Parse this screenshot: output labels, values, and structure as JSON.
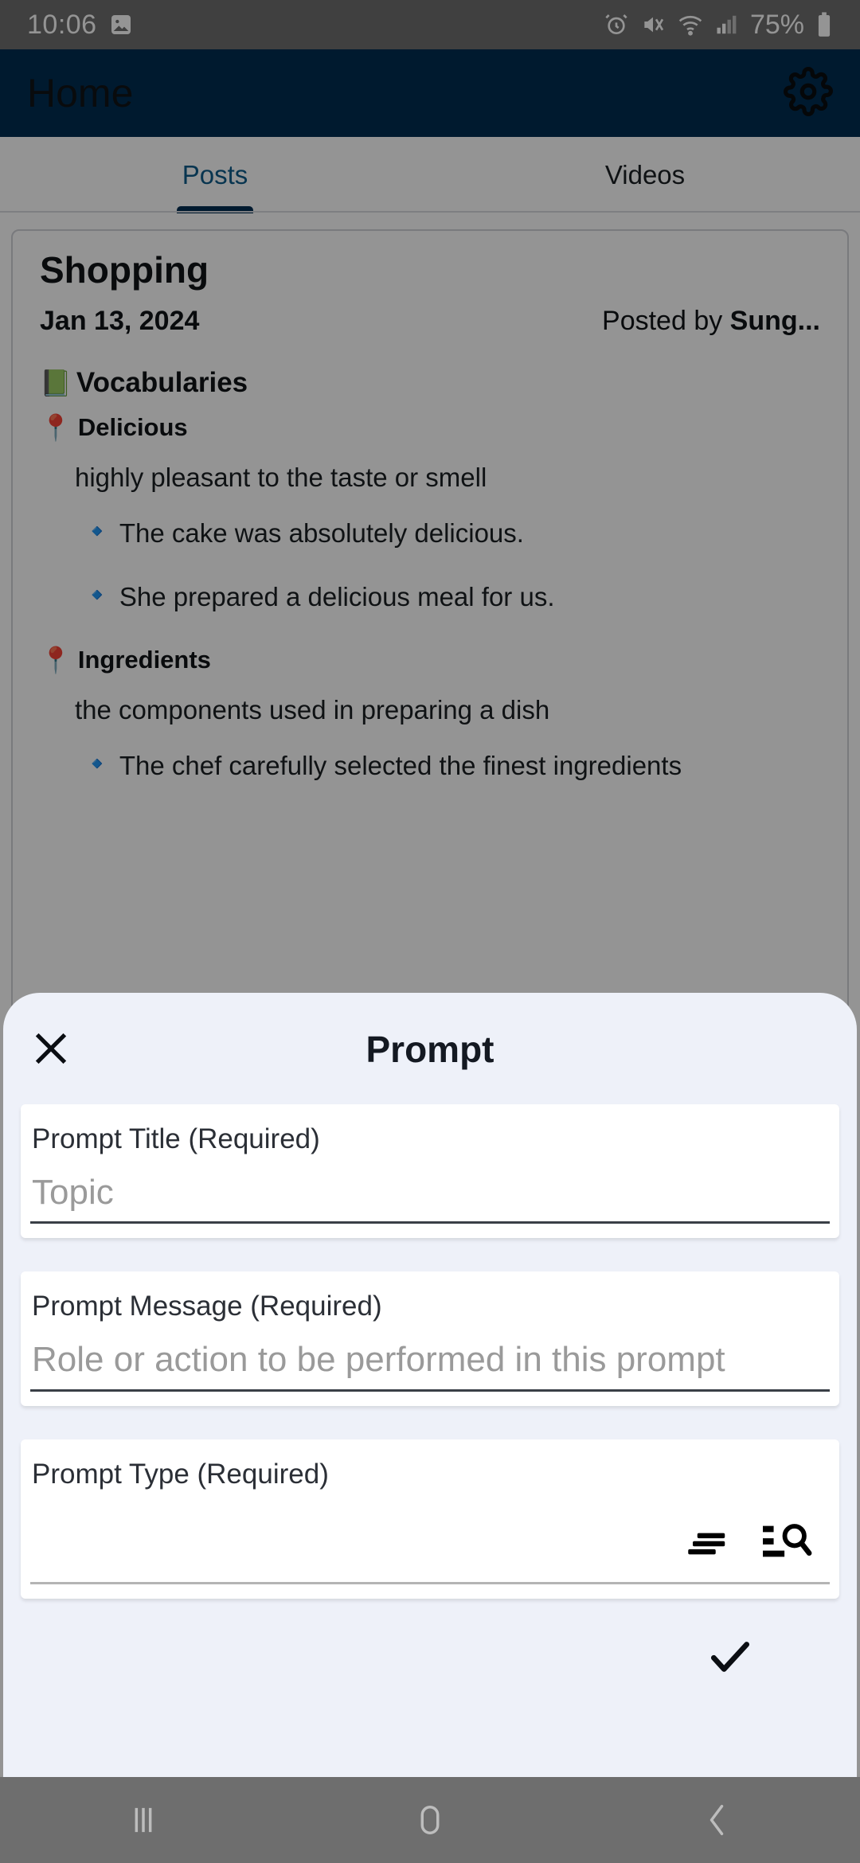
{
  "status_bar": {
    "time": "10:06",
    "battery_percent": "75%",
    "icons": [
      "image-icon",
      "alarm-icon",
      "mute-vibrate-icon",
      "wifi-icon",
      "cellular-signal-icon",
      "battery-icon"
    ]
  },
  "app_bar": {
    "title": "Home",
    "settings_icon": "gear-icon"
  },
  "tabs": [
    {
      "label": "Posts",
      "selected": true
    },
    {
      "label": "Videos",
      "selected": false
    }
  ],
  "post": {
    "title": "Shopping",
    "date": "Jan 13, 2024",
    "posted_by_prefix": "Posted by ",
    "posted_by_name": "Sung...",
    "section_icon": "green-book-emoji",
    "section_title": "Vocabularies",
    "entries": [
      {
        "pin_icon": "round-pushpin-emoji",
        "word": "Delicious",
        "definition": "highly pleasant to the taste or smell",
        "examples": [
          "The cake was absolutely delicious.",
          "She prepared a delicious meal for us."
        ]
      },
      {
        "pin_icon": "round-pushpin-emoji",
        "word": "Ingredients",
        "definition": "the components used in preparing a dish",
        "examples": [
          "The chef carefully selected the finest ingredients"
        ]
      }
    ],
    "bullet_icon": "blue-diamond-emoji"
  },
  "sheet": {
    "title": "Prompt",
    "close_icon": "close-icon",
    "fields": [
      {
        "label": "Prompt Title (Required)",
        "value": "",
        "placeholder": "Topic"
      },
      {
        "label": "Prompt Message (Required)",
        "value": "",
        "placeholder": "Role or action to be performed in this prompt"
      },
      {
        "label": "Prompt Type (Required)",
        "value": "",
        "placeholder": ""
      }
    ],
    "type_icons": [
      "sort-lines-icon",
      "list-search-icon"
    ],
    "confirm_icon": "check-icon"
  },
  "nav_bar": {
    "recents_label": "recents-icon",
    "home_label": "home-icon",
    "back_label": "back-icon"
  },
  "colors": {
    "app_bar": "#002E51",
    "tab_selected": "#0E5C8A",
    "sheet_bg": "#EEF1F9",
    "system_bar": "#6E6E6E"
  }
}
